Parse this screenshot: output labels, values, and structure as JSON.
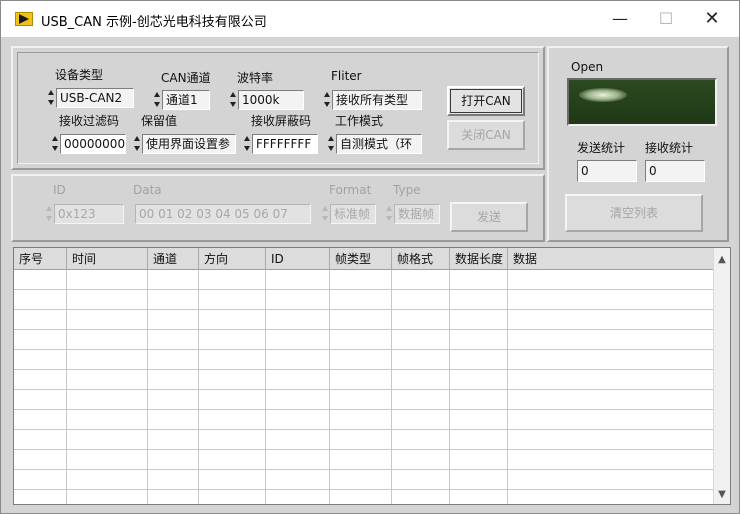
{
  "window": {
    "title": "USB_CAN 示例-创芯光电科技有限公司"
  },
  "config": {
    "device_type": {
      "label": "设备类型",
      "value": "USB-CAN2"
    },
    "can_channel": {
      "label": "CAN通道",
      "value": "通道1"
    },
    "baud_rate": {
      "label": "波特率",
      "value": "1000k"
    },
    "filter": {
      "label": "Fliter",
      "value": "接收所有类型"
    },
    "acc_code": {
      "label": "接收过滤码",
      "value": "00000000"
    },
    "reserved": {
      "label": "保留值",
      "value": "使用界面设置参"
    },
    "acc_mask": {
      "label": "接收屏蔽码",
      "value": "FFFFFFFF"
    },
    "work_mode": {
      "label": "工作模式",
      "value": "自测模式（环"
    },
    "open_can_label": "打开CAN",
    "close_can_label": "关闭CAN"
  },
  "send": {
    "id": {
      "label": "ID",
      "value": "0x123"
    },
    "data": {
      "label": "Data",
      "value": "00 01 02 03 04 05 06 07"
    },
    "format": {
      "label": "Format",
      "value": "标准帧"
    },
    "type": {
      "label": "Type",
      "value": "数据帧"
    },
    "send_label": "发送"
  },
  "status": {
    "indicator_label": "Open",
    "send_count": {
      "label": "发送统计",
      "value": "0"
    },
    "recv_count": {
      "label": "接收统计",
      "value": "0"
    },
    "clear_label": "清空列表"
  },
  "table": {
    "columns": [
      "序号",
      "时间",
      "通道",
      "方向",
      "ID",
      "帧类型",
      "帧格式",
      "数据长度",
      "数据"
    ]
  }
}
